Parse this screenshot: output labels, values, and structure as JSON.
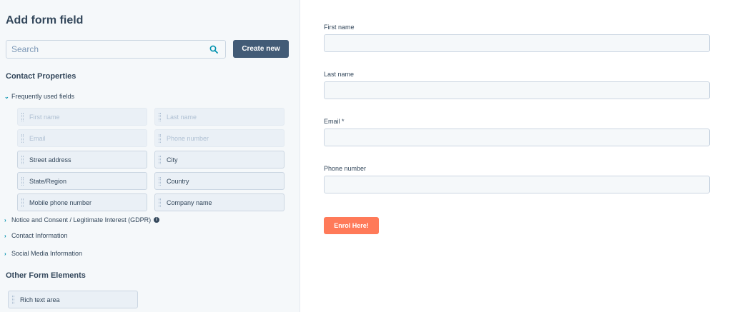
{
  "panel": {
    "title": "Add form field",
    "search_placeholder": "Search",
    "create_new_label": "Create new",
    "contact_properties_heading": "Contact Properties",
    "frequently_used_label": "Frequently used fields",
    "fields": [
      {
        "label": "First name",
        "enabled": false
      },
      {
        "label": "Last name",
        "enabled": false
      },
      {
        "label": "Email",
        "enabled": false
      },
      {
        "label": "Phone number",
        "enabled": false
      },
      {
        "label": "Street address",
        "enabled": true
      },
      {
        "label": "City",
        "enabled": true
      },
      {
        "label": "State/Region",
        "enabled": true
      },
      {
        "label": "Country",
        "enabled": true
      },
      {
        "label": "Mobile phone number",
        "enabled": true
      },
      {
        "label": "Company name",
        "enabled": true
      }
    ],
    "groups": [
      {
        "label": "Notice and Consent / Legitimate Interest (GDPR)",
        "info_icon": "info-icon"
      },
      {
        "label": "Contact Information"
      },
      {
        "label": "Social Media Information"
      }
    ],
    "other_elements_heading": "Other Form Elements",
    "other_elements": [
      {
        "label": "Rich text area"
      }
    ]
  },
  "form": {
    "fields": [
      {
        "label": "First name",
        "value": ""
      },
      {
        "label": "Last name",
        "value": ""
      },
      {
        "label": "Email *",
        "value": ""
      },
      {
        "label": "Phone number",
        "value": ""
      }
    ],
    "submit_label": "Enrol Here!"
  },
  "colors": {
    "panel_bg": "#f5f8fa",
    "primary_button": "#425b76",
    "submit_button": "#ff7a59",
    "accent": "#0091ae",
    "text": "#33475b"
  }
}
